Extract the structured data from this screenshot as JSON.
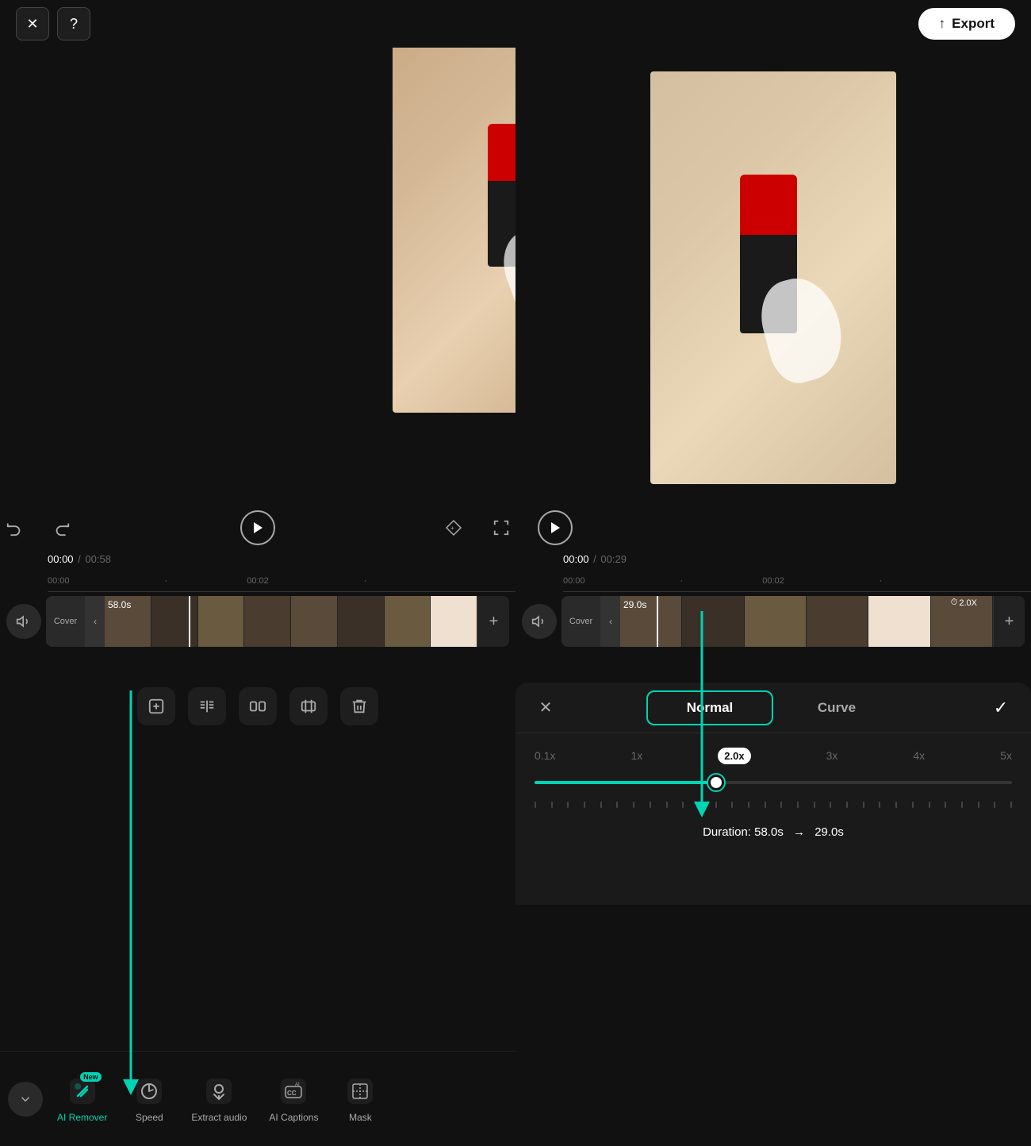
{
  "topbar": {
    "close_label": "✕",
    "help_label": "?",
    "export_icon": "↑",
    "export_label": "Export"
  },
  "preview": {
    "left": {
      "time_current": "00:00",
      "time_total": "00:58"
    },
    "right": {
      "time_current": "00:00",
      "time_total": "00:29"
    }
  },
  "timeline_left": {
    "time_current": "00:00",
    "time_total": "00:58",
    "ruler": [
      "00:00",
      "00:02"
    ],
    "track_duration": "58.0s",
    "cover_label": "Cover"
  },
  "timeline_right": {
    "time_current": "00:00",
    "time_total": "00:29",
    "ruler": [
      "00:00",
      "00:02"
    ],
    "track_duration": "29.0s",
    "speed_badge": "⏱2.0X",
    "cover_label": "Cover"
  },
  "speed_panel": {
    "close_icon": "✕",
    "check_icon": "✓",
    "tabs": [
      {
        "label": "Normal",
        "active": true
      },
      {
        "label": "Curve",
        "active": false
      }
    ],
    "speed_labels": [
      "0.1x",
      "1x",
      "2.0x",
      "3x",
      "4x",
      "5x"
    ],
    "current_speed": "2.0x",
    "duration_from": "58.0s",
    "duration_to": "29.0s",
    "duration_label": "Duration:"
  },
  "edit_tools": [
    {
      "icon": "⊞",
      "name": "add"
    },
    {
      "icon": "⊟⊟",
      "name": "split"
    },
    {
      "icon": "⊢⊣",
      "name": "trim"
    },
    {
      "icon": "⊣⊢",
      "name": "crop"
    },
    {
      "icon": "🗑",
      "name": "delete"
    }
  ],
  "bottom_nav": {
    "toggle_icon": "∨",
    "items": [
      {
        "icon": "🤖",
        "label": "AI Remover",
        "badge": "New",
        "active": true
      },
      {
        "icon": "⏱",
        "label": "Speed",
        "active": false
      },
      {
        "icon": "🎵",
        "label": "Extract audio",
        "active": false
      },
      {
        "icon": "CC",
        "label": "AI Captions",
        "active": false
      },
      {
        "icon": "⊡",
        "label": "Mask",
        "active": false
      }
    ]
  }
}
